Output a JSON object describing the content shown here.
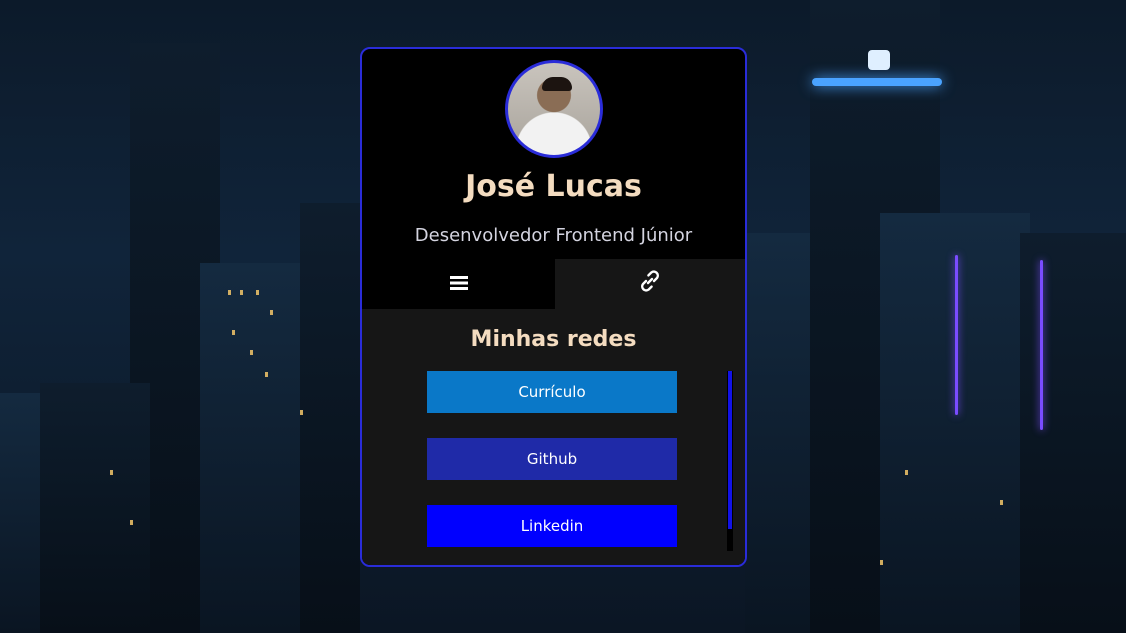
{
  "profile": {
    "name": "José Lucas",
    "role": "Desenvolvedor Frontend Júnior"
  },
  "tabs": [
    {
      "icon": "menu-icon",
      "active": false
    },
    {
      "icon": "link-icon",
      "active": true
    }
  ],
  "section": {
    "title": "Minhas redes"
  },
  "links": [
    {
      "label": "Currículo",
      "color": "#0a78c8"
    },
    {
      "label": "Github",
      "color": "#1f2aa8"
    },
    {
      "label": "Linkedin",
      "color": "#0000ff"
    }
  ],
  "colors": {
    "card_border": "#2a2cd9",
    "name_text": "#f4dcc0",
    "panel_bg": "#161616"
  }
}
